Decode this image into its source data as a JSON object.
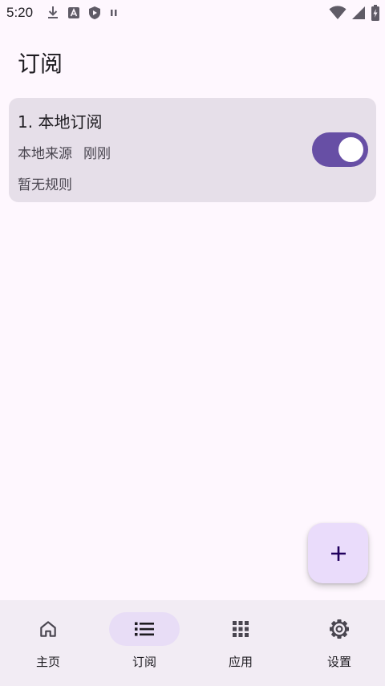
{
  "status_bar": {
    "time": "5:20",
    "left_icons": [
      "download-icon",
      "android-app-icon",
      "shield-play-icon",
      "pause-icon"
    ],
    "right_icons": [
      "wifi-icon",
      "signal-icon",
      "battery-charging-icon"
    ]
  },
  "header": {
    "title": "订阅"
  },
  "subscriptions": [
    {
      "title": "1. 本地订阅",
      "source": "本地来源",
      "updated": "刚刚",
      "rules": "暂无规则",
      "enabled": true
    }
  ],
  "fab": {
    "icon": "add-icon"
  },
  "bottom_nav": {
    "items": [
      {
        "label": "主页",
        "icon": "home-icon",
        "active": false
      },
      {
        "label": "订阅",
        "icon": "list-icon",
        "active": true
      },
      {
        "label": "应用",
        "icon": "apps-grid-icon",
        "active": false
      },
      {
        "label": "设置",
        "icon": "settings-gear-icon",
        "active": false
      }
    ]
  },
  "colors": {
    "background": "#fef7fe",
    "card": "#e6dfe9",
    "accent": "#674fa5",
    "fab": "#eadcfb",
    "nav_background": "#f2ecf4",
    "nav_indicator": "#e8ddf6"
  }
}
